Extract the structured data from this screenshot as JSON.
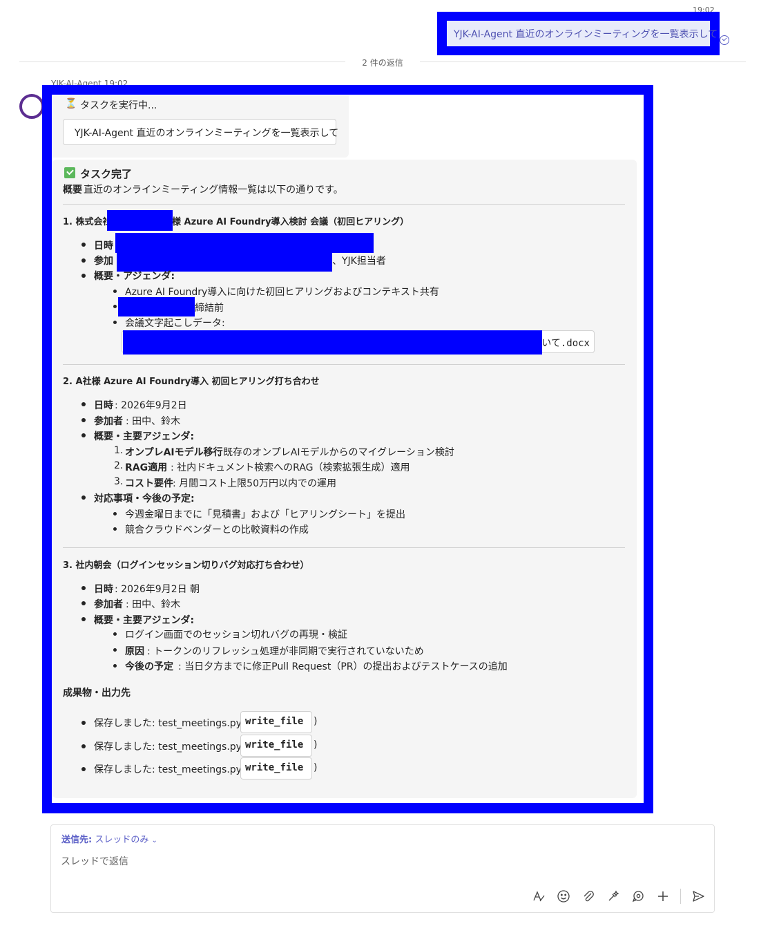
{
  "user_message": {
    "time": "19:02",
    "text": "YJK-AI-Agent 直近のオンラインミーティングを一覧表示して"
  },
  "divider": {
    "text": "2 件の返信"
  },
  "agent": {
    "name_time": "YJK-AI-Agent  19:02",
    "working_label": "タスクを実行中...",
    "quoted_request": "YJK-AI-Agent 直近のオンラインミーティングを一覧表示して",
    "result_title": "タスク完了",
    "summary_label": "概要",
    "summary_text": " 直近のオンラインミーティング情報一覧は以下の通りです。",
    "meeting1": {
      "title_a": "1. 株式会社",
      "title_b": "様 Azure AI Foundry導入検討 会議（初回ヒアリング）",
      "date_label": "日時",
      "participants_label": "参加",
      "participants_tail": "、YJK担当者",
      "agenda_label": "概要・アジェンダ:",
      "agenda_1": "Azure AI Foundry導入に向けた初回ヒアリングおよびコンテキスト共有",
      "agenda_2_tail": "締結前",
      "agenda_3": "会議文字起こしデータ:",
      "file_tail": "いて.docx"
    },
    "meeting2": {
      "title": "2. A社様 Azure AI Foundry導入 初回ヒアリング打ち合わせ",
      "date_label": "日時",
      "date_value": ": 2026年9月2日",
      "participants_label": "参加者",
      "participants_value": ": 田中、鈴木",
      "agenda_label": "概要・主要アジェンダ:",
      "agenda": [
        {
          "num": "1.",
          "label": "オンプレAIモデル移行",
          "value": ": 既存のオンプレAIモデルからのマイグレーション検討"
        },
        {
          "num": "2.",
          "label": "RAG適用",
          "value": ": 社内ドキュメント検索へのRAG（検索拡張生成）適用"
        },
        {
          "num": "3.",
          "label": "コスト要件",
          "value": ": 月間コスト上限50万円以内での運用"
        }
      ],
      "todo_label": "対応事項・今後の予定:",
      "todo": [
        "今週金曜日までに「見積書」および「ヒアリングシート」を提出",
        "競合クラウドベンダーとの比較資料の作成"
      ]
    },
    "meeting3": {
      "title": "3. 社内朝会（ログインセッション切りバグ対応打ち合わせ）",
      "date_label": "日時",
      "date_value": ": 2026年9月2日 朝",
      "participants_label": "参加者",
      "participants_value": ": 田中、鈴木",
      "agenda_label": "概要・主要アジェンダ:",
      "agenda_1": "ログイン画面でのセッション切れバグの再現・検証",
      "cause_label": "原因",
      "cause_value": ": トークンのリフレッシュ処理が非同期で実行されていないため",
      "plan_label": "今後の予定",
      "plan_value": ": 当日夕方までに修正Pull Request（PR）の提出およびテストケースの追加"
    },
    "outputs_label": "成果物・出力先",
    "outputs": [
      {
        "text": "保存しました: test_meetings.py (",
        "code": "write_file",
        "close": ")"
      },
      {
        "text": "保存しました: test_meetings.py (",
        "code": "write_file",
        "close": ")"
      },
      {
        "text": "保存しました: test_meetings.py (",
        "code": "write_file",
        "close": ")"
      }
    ]
  },
  "compose": {
    "send_to_label": "送信先:",
    "send_to_value": "スレッドのみ",
    "placeholder": "スレッドで返信"
  },
  "icons": {
    "format": "format-icon",
    "emoji": "emoji-icon",
    "attach": "attach-icon",
    "loop": "loop-icon",
    "copilot": "copilot-icon",
    "add": "add-icon",
    "send": "send-icon",
    "accent": "#5b5fc7",
    "redaction": "#0000ff"
  }
}
